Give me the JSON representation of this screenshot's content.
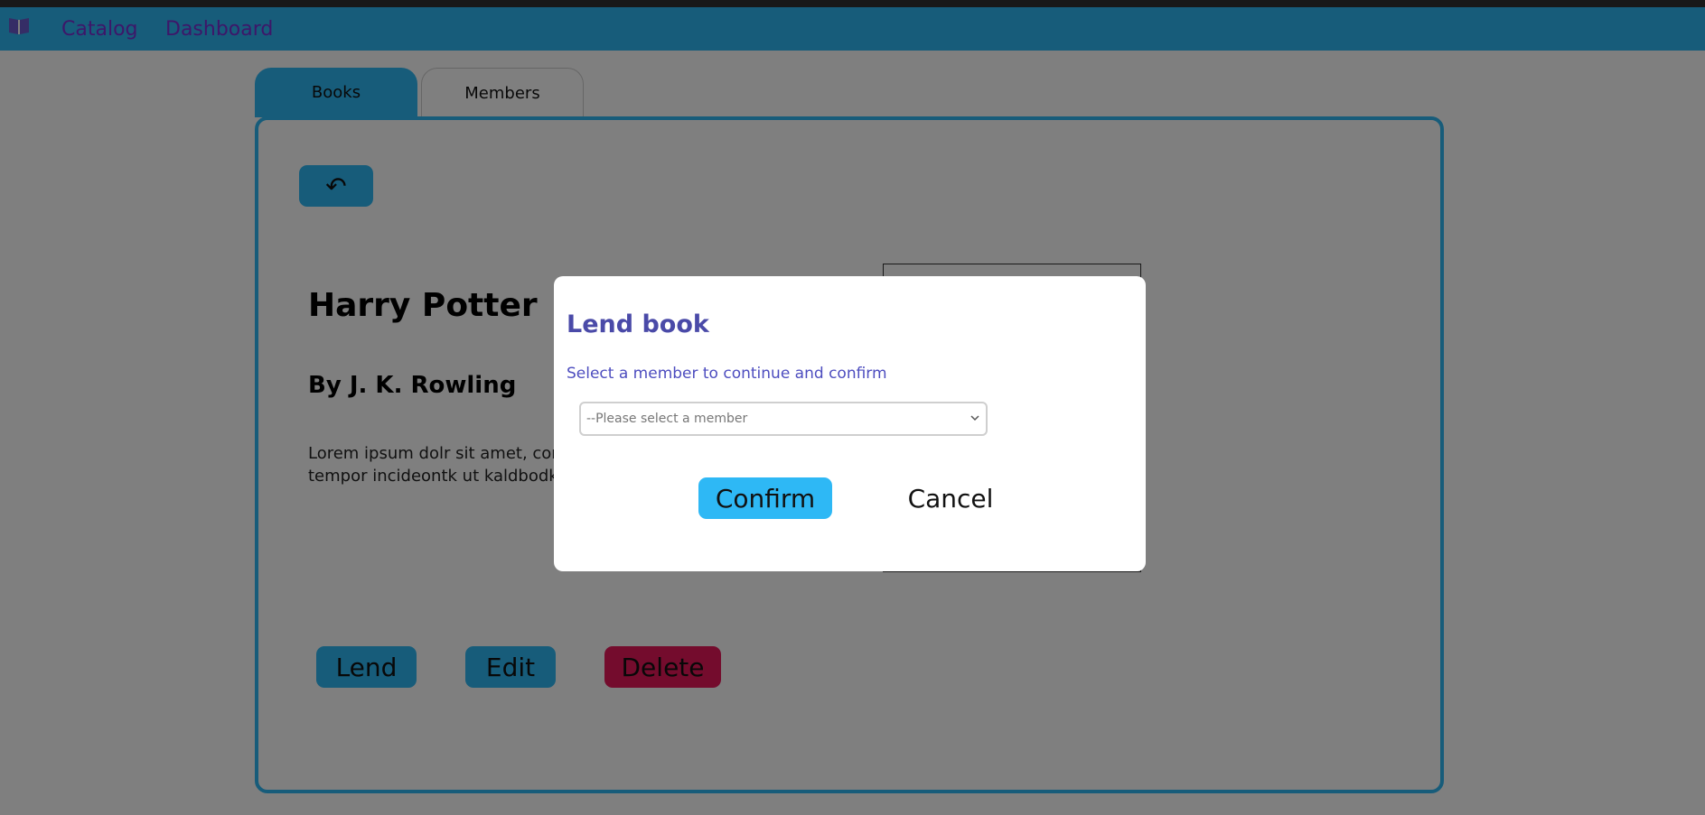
{
  "navbar": {
    "logo_icon": "book-open-icon",
    "links": [
      {
        "label": "Catalog"
      },
      {
        "label": "Dashboard"
      }
    ]
  },
  "tabs": [
    {
      "label": "Books",
      "active": true
    },
    {
      "label": "Members",
      "active": false
    }
  ],
  "book": {
    "back_icon": "undo-arrow-icon",
    "back_symbol": "↶",
    "title": "Harry Potter",
    "author": "By J. K. Rowling",
    "description_line1": "Lorem ipsum dolr sit amet, consec",
    "description_line2": "tempor incideontk ut kaldbodkr et"
  },
  "actions": {
    "lend_label": "Lend",
    "edit_label": "Edit",
    "delete_label": "Delete"
  },
  "modal": {
    "title": "Lend book",
    "subtitle": "Select a member to continue and confirm",
    "select_value": "--Please select a member",
    "confirm_label": "Confirm",
    "cancel_label": "Cancel"
  },
  "colors": {
    "primary": "#2eb8f5",
    "danger": "#e8185a",
    "nav_link": "#7b2fd3",
    "modal_title": "#4a4aa8",
    "overlay": "rgba(0,0,0,0.5)"
  }
}
